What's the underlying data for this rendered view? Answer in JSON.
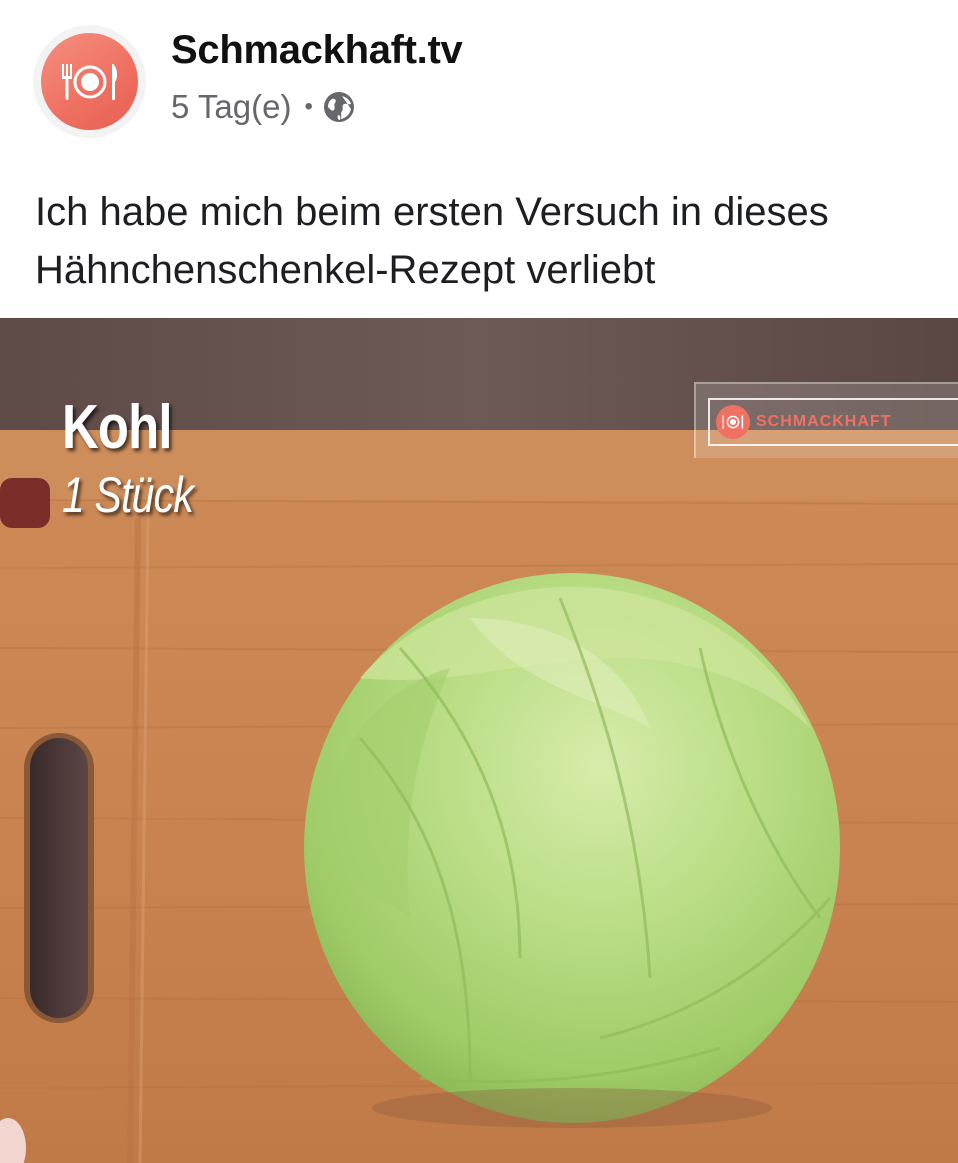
{
  "post": {
    "page_name": "Schmackhaft.tv",
    "time": "5 Tag(e)",
    "separator": "•",
    "privacy_icon": "globe-icon",
    "text": "Ich habe mich beim ersten Versuch in dieses Hähnchenschenkel-Rezept verliebt"
  },
  "avatar": {
    "icon": "plate-cutlery-icon",
    "color": "#ef7163"
  },
  "media": {
    "caption_title": "Kohl",
    "caption_sub": "1 Stück",
    "watermark_text": "SCHMACKHAFT",
    "watermark_icon": "plate-cutlery-icon"
  },
  "colors": {
    "brand": "#ef7163",
    "meta_text": "#65676b",
    "body_text": "#1c1e21"
  }
}
